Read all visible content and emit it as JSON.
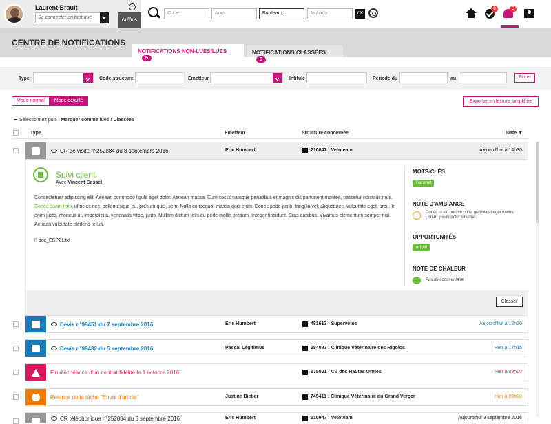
{
  "user": {
    "name": "Laurent Brault",
    "impersonate_placeholder": "Se connecter en tant que",
    "tools": "OUTILS"
  },
  "search": {
    "code_ph": "Code",
    "nom_ph": "Nom",
    "city_value": "Bordeaux",
    "individu_ph": "Individu",
    "ok": "OK"
  },
  "badges": {
    "tasks": "8",
    "notifications": "5"
  },
  "page": {
    "title": "CENTRE DE NOTIFICATIONS"
  },
  "tabs": [
    {
      "label": "NOTIFICATIONS NON-LUES/LUES",
      "count": "5"
    },
    {
      "label": "NOTIFICATIONS CLASSÉES",
      "count": "0"
    }
  ],
  "filters": {
    "type": "Type",
    "code": "Code structure",
    "emetteur": "Emetteur",
    "intitule": "Intitulé",
    "periode": "Période du",
    "au": "au",
    "btn": "Filtrer"
  },
  "modes": {
    "normal": "Mode normal",
    "detail": "Mode détaillé",
    "export": "Exporter en lecture simplifiée"
  },
  "selection": {
    "prefix": "Sélectionnez puis :",
    "mark": "Marquer comme lues",
    "sep": "/",
    "classees": "Classées"
  },
  "columns": {
    "type": "Type",
    "emetteur": "Emetteur",
    "structure": "Structure concernée",
    "date": "Date"
  },
  "rows": [
    {
      "title": "CR de visite n°252884 du 8 septembre 2016",
      "emetteur": "Eric Humbert",
      "structure": "210047 : Vetoteam",
      "date": "Aujourd'hui à 14h30"
    },
    {
      "title": "Devis n°99451 du 7 septembre 2016",
      "emetteur": "Eric Humbert",
      "structure": "481613 : Supervétos",
      "date": "Aujourd'hui à 12h30"
    },
    {
      "title": "Devis n°99432 du 5 septembre 2016",
      "emetteur": "Pascal Légitimus",
      "structure": "284087 : Clinique Vétérinaire des Rigolos",
      "date": "Hier à 17h15"
    },
    {
      "title": "Fin d'échéance d'un contrat fidélité le 1 octobre 2016",
      "emetteur": "",
      "structure": "975001 : CV des Hautes Ormes",
      "date": "Hier à 09h00"
    },
    {
      "title": "Relance de la tâche \"Envoi d'article\"",
      "emetteur": "Justine Bieber",
      "structure": "745411 : Clinique Vétérinaire du Grand Verger",
      "date": "Hier à 09h00"
    },
    {
      "title": "CR téléphonique n°252884 du 5 septembre 2016",
      "emetteur": "Eric Humbert",
      "structure": "210047 : Vetoteam",
      "date": "Aujourd'hui 9 septembre 2016"
    }
  ],
  "detail": {
    "title": "Suivi client",
    "avec_label": "Avec",
    "avec": "Vincent Cassel",
    "text1": "Consectetuer adipiscing elit. Aenean commodo ligula eget dolor. Aenean massa. Cum sociis natoque penatibus et magnis dis parturient montes, nascetur ridiculus mus.",
    "link": "Donec quam felis,",
    "text2": "ultricies nec, pellentesque eu, pretium quis, sem. Nulla consequat massa quis enim. Donec pede justo, fringilla vel, aliquet nec, vulputate eget, arcu. In enim justo, rhoncus ut, imperdiet a, venenatis vitae, justo. Nullam dictum felis eu pede mollis pretium. Integer tincidunt. Cras dapibus. Vivamus elementum semper nisi. Aenean vulputate eleifend tellus.",
    "file": "doc_ESP21.txt",
    "motscles": "MOTS-CLÉS",
    "tag": "Transnet",
    "ambiance": "NOTE D'AMBIANCE",
    "ambiance_txt": "Donec id elit non mi porta gravida at eget metus. Lorem ipsum dolor sit amet.",
    "opport": "OPPORTUNITÉS",
    "opport_tag": "★ iVet",
    "chaleur": "NOTE DE CHALEUR",
    "chaleur_txt": "Pas de commentaire",
    "classer": "Classer"
  },
  "colors": {
    "accent": "#c3177f",
    "green": "#6dbb3c",
    "blue": "#1c7bb5",
    "red": "#d61a5e",
    "orange": "#f07c00",
    "grey": "#999999"
  }
}
